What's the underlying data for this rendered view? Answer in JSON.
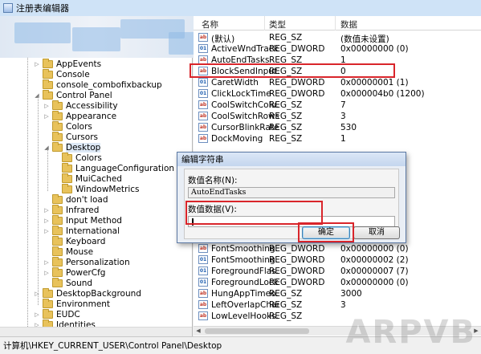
{
  "window": {
    "title": "注册表编辑器"
  },
  "tree": {
    "items": [
      {
        "label": "AppEvents",
        "depth": 1,
        "expandable": true
      },
      {
        "label": "Console",
        "depth": 1,
        "expandable": false
      },
      {
        "label": "console_combofixbackup",
        "depth": 1,
        "expandable": false
      },
      {
        "label": "Control Panel",
        "depth": 1,
        "expandable": true,
        "expanded": true
      },
      {
        "label": "Accessibility",
        "depth": 2,
        "expandable": true
      },
      {
        "label": "Appearance",
        "depth": 2,
        "expandable": true
      },
      {
        "label": "Colors",
        "depth": 2,
        "expandable": false
      },
      {
        "label": "Cursors",
        "depth": 2,
        "expandable": false
      },
      {
        "label": "Desktop",
        "depth": 2,
        "expandable": true,
        "expanded": true,
        "selected": true
      },
      {
        "label": "Colors",
        "depth": 3,
        "expandable": false
      },
      {
        "label": "LanguageConfiguration",
        "depth": 3,
        "expandable": false
      },
      {
        "label": "MuiCached",
        "depth": 3,
        "expandable": false
      },
      {
        "label": "WindowMetrics",
        "depth": 3,
        "expandable": false
      },
      {
        "label": "don't load",
        "depth": 2,
        "expandable": false
      },
      {
        "label": "Infrared",
        "depth": 2,
        "expandable": true
      },
      {
        "label": "Input Method",
        "depth": 2,
        "expandable": true
      },
      {
        "label": "International",
        "depth": 2,
        "expandable": true
      },
      {
        "label": "Keyboard",
        "depth": 2,
        "expandable": false
      },
      {
        "label": "Mouse",
        "depth": 2,
        "expandable": false
      },
      {
        "label": "Personalization",
        "depth": 2,
        "expandable": true
      },
      {
        "label": "PowerCfg",
        "depth": 2,
        "expandable": true
      },
      {
        "label": "Sound",
        "depth": 2,
        "expandable": false
      },
      {
        "label": "DesktopBackground",
        "depth": 1,
        "expandable": true
      },
      {
        "label": "Environment",
        "depth": 1,
        "expandable": false
      },
      {
        "label": "EUDC",
        "depth": 1,
        "expandable": true
      },
      {
        "label": "Identities",
        "depth": 1,
        "expandable": true
      }
    ]
  },
  "list": {
    "columns": {
      "name": "名称",
      "type": "类型",
      "data": "数据"
    },
    "rows_top": [
      {
        "icon": "ab",
        "name": "(默认)",
        "type": "REG_SZ",
        "data": "(数值未设置)"
      },
      {
        "icon": "dw",
        "name": "ActiveWndTrack...",
        "type": "REG_DWORD",
        "data": "0x00000000 (0)"
      },
      {
        "icon": "ab",
        "name": "AutoEndTasks",
        "type": "REG_SZ",
        "data": "1"
      },
      {
        "icon": "ab",
        "name": "BlockSendInput...",
        "type": "REG_SZ",
        "data": "0"
      },
      {
        "icon": "dw",
        "name": "CaretWidth",
        "type": "REG_DWORD",
        "data": "0x00000001 (1)"
      },
      {
        "icon": "dw",
        "name": "ClickLockTime",
        "type": "REG_DWORD",
        "data": "0x000004b0 (1200)"
      },
      {
        "icon": "ab",
        "name": "CoolSwitchColu...",
        "type": "REG_SZ",
        "data": "7"
      },
      {
        "icon": "ab",
        "name": "CoolSwitchRows",
        "type": "REG_SZ",
        "data": "3"
      },
      {
        "icon": "ab",
        "name": "CursorBlinkRate",
        "type": "REG_SZ",
        "data": "530"
      },
      {
        "icon": "ab",
        "name": "DockMoving",
        "type": "REG_SZ",
        "data": "1"
      }
    ],
    "rows_bottom": [
      {
        "icon": "ab",
        "name": "FontSmoothing...",
        "type": "REG_DWORD",
        "data": "0x00000000 (0)"
      },
      {
        "icon": "dw",
        "name": "FontSmoothing...",
        "type": "REG_DWORD",
        "data": "0x00000002 (2)"
      },
      {
        "icon": "dw",
        "name": "ForegroundFlas...",
        "type": "REG_DWORD",
        "data": "0x00000007 (7)"
      },
      {
        "icon": "dw",
        "name": "ForegroundLock...",
        "type": "REG_DWORD",
        "data": "0x00000000 (0)"
      },
      {
        "icon": "ab",
        "name": "HungAppTimeo...",
        "type": "REG_SZ",
        "data": "3000"
      },
      {
        "icon": "ab",
        "name": "LeftOverlapChars",
        "type": "REG_SZ",
        "data": "3"
      },
      {
        "icon": "ab",
        "name": "LowLevelHooks...",
        "type": "REG_SZ",
        "data": ""
      }
    ]
  },
  "dialog": {
    "title": "编辑字符串",
    "name_label": "数值名称(N):",
    "name_value": "AutoEndTasks",
    "data_label": "数值数据(V):",
    "data_value": "",
    "ok_label": "确定",
    "cancel_label": "取消"
  },
  "statusbar": {
    "path": "计算机\\HKEY_CURRENT_USER\\Control Panel\\Desktop"
  },
  "watermark": {
    "text": "ARPVB"
  },
  "colors": {
    "highlight": "#d9252b",
    "folder": "#e8c25b"
  }
}
